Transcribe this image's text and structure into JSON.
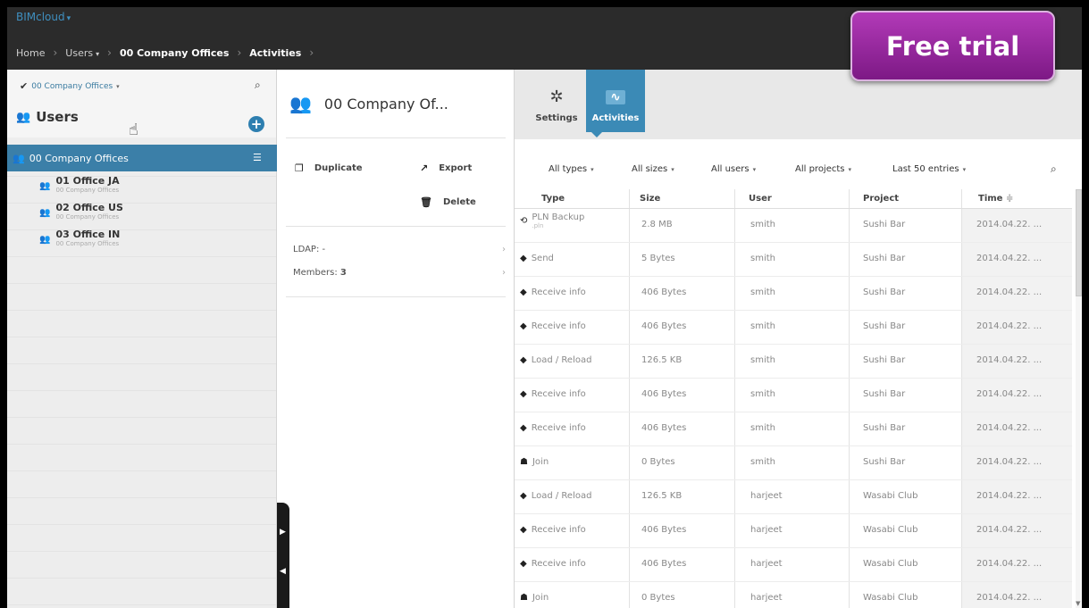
{
  "app": {
    "title": "BIMcloud",
    "title_caret": "▾"
  },
  "breadcrumb": {
    "items": [
      "Home",
      "Users",
      "00 Company Offices",
      "Activities"
    ],
    "separator": "›"
  },
  "promo": {
    "label": "Free trial",
    "color": "#9b2aa3"
  },
  "left": {
    "scope": "00 Company Offices",
    "title": "Users",
    "selected_group": "00 Company Offices",
    "children": [
      {
        "name": "01 Office JA",
        "parent": "00 Company Offices"
      },
      {
        "name": "02 Office US",
        "parent": "00 Company Offices"
      },
      {
        "name": "03 Office IN",
        "parent": "00 Company Offices"
      }
    ]
  },
  "middle": {
    "title": "00 Company Of...",
    "actions": {
      "duplicate": "Duplicate",
      "export": "Export",
      "delete": "Delete"
    },
    "ldap_label": "LDAP: -",
    "members_label": "Members:",
    "members_count": "3"
  },
  "tabs": {
    "settings": "Settings",
    "activities": "Activities",
    "active": "Activities",
    "accent": "#3b8ab6"
  },
  "filters": {
    "types": "All types",
    "sizes": "All sizes",
    "users": "All users",
    "projects": "All projects",
    "entries": "Last 50 entries"
  },
  "grid": {
    "columns": [
      "Type",
      "Size",
      "User",
      "Project",
      "Time"
    ],
    "rows": [
      {
        "type": "PLN Backup",
        "sub": ".pln",
        "size": "2.8 MB",
        "user": "smith",
        "project": "Sushi Bar",
        "time": "2014.04.22. ..."
      },
      {
        "type": "Send",
        "size": "5 Bytes",
        "user": "smith",
        "project": "Sushi Bar",
        "time": "2014.04.22. ..."
      },
      {
        "type": "Receive info",
        "size": "406 Bytes",
        "user": "smith",
        "project": "Sushi Bar",
        "time": "2014.04.22. ..."
      },
      {
        "type": "Receive info",
        "size": "406 Bytes",
        "user": "smith",
        "project": "Sushi Bar",
        "time": "2014.04.22. ..."
      },
      {
        "type": "Load / Reload",
        "size": "126.5 KB",
        "user": "smith",
        "project": "Sushi Bar",
        "time": "2014.04.22. ..."
      },
      {
        "type": "Receive info",
        "size": "406 Bytes",
        "user": "smith",
        "project": "Sushi Bar",
        "time": "2014.04.22. ..."
      },
      {
        "type": "Receive info",
        "size": "406 Bytes",
        "user": "smith",
        "project": "Sushi Bar",
        "time": "2014.04.22. ..."
      },
      {
        "type": "Join",
        "size": "0 Bytes",
        "user": "smith",
        "project": "Sushi Bar",
        "time": "2014.04.22. ..."
      },
      {
        "type": "Load / Reload",
        "size": "126.5 KB",
        "user": "harjeet",
        "project": "Wasabi Club",
        "time": "2014.04.22. ..."
      },
      {
        "type": "Receive info",
        "size": "406 Bytes",
        "user": "harjeet",
        "project": "Wasabi Club",
        "time": "2014.04.22. ..."
      },
      {
        "type": "Receive info",
        "size": "406 Bytes",
        "user": "harjeet",
        "project": "Wasabi Club",
        "time": "2014.04.22. ..."
      },
      {
        "type": "Join",
        "size": "0 Bytes",
        "user": "harjeet",
        "project": "Wasabi Club",
        "time": "2014.04.22. ..."
      }
    ]
  }
}
